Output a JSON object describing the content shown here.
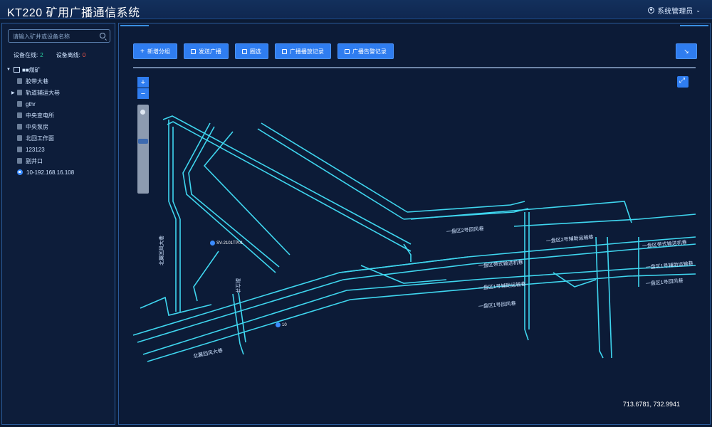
{
  "app": {
    "title": "KT220 矿用广播通信系统",
    "user": "系统管理员"
  },
  "sidebar": {
    "search_placeholder": "请输入矿井或设备名称",
    "online_label": "设备在线:",
    "online_count": "2",
    "offline_label": "设备离线:",
    "offline_count": "0",
    "root": "■■煤矿",
    "items": [
      {
        "label": "胶带大巷"
      },
      {
        "label": "轨道辅运大巷"
      },
      {
        "label": "gthr"
      },
      {
        "label": "中央变电所"
      },
      {
        "label": "中央泵房"
      },
      {
        "label": "北回工作面"
      },
      {
        "label": "123123"
      },
      {
        "label": "副井口"
      },
      {
        "label": "10-192.168.16.108"
      }
    ]
  },
  "toolbar": {
    "add_group": "新增分组",
    "send_broadcast": "发送广播",
    "circle_select": "圈选",
    "play_records": "广播播放记录",
    "alarm_records": "广播告警记录"
  },
  "map": {
    "coordinates": "713.6781, 732.9941",
    "devices": [
      {
        "label": "SV-2101TP01"
      },
      {
        "label": "10"
      }
    ],
    "labels": [
      "北翼回风大巷",
      "北翼回风大巷",
      "一盘区2号回风巷",
      "一盘区2号辅助运输巷",
      "一盘区带式输送机巷",
      "一盘区带式输送机巷",
      "一盘区1号辅助运输巷",
      "一盘区1号辅助运输巷",
      "一盘区1号回风巷",
      "一盘区1号回风巷",
      "风井",
      "副立井"
    ]
  }
}
